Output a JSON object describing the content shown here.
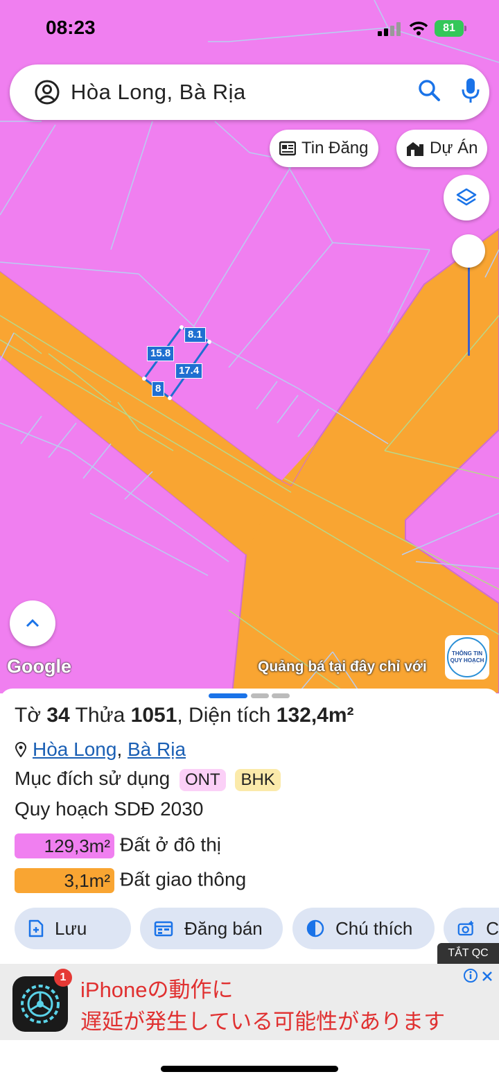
{
  "status_bar": {
    "time": "08:23",
    "battery": "81"
  },
  "search": {
    "query": "Hòa Long, Bà Rịa"
  },
  "chips": {
    "listings": "Tin Đăng",
    "projects": "Dự Án"
  },
  "map": {
    "attribution": "Google",
    "promo": "Quảng bá tại đây chỉ với",
    "logo_line1": "THÔNG TIN",
    "logo_line2": "QUY HOẠCH",
    "measurements": {
      "top": "8.1",
      "left": "15.8",
      "right": "17.4",
      "bottom": "8"
    }
  },
  "parcel": {
    "sheet_label": "Tờ",
    "sheet_no": "34",
    "plot_label": "Thửa",
    "plot_no": "1051",
    "area_label": ", Diện tích",
    "area_value": "132,4m²",
    "ward": "Hòa Long",
    "city": "Bà Rịa",
    "usage_label": "Mục đích sử dụng",
    "usage_tags": [
      "ONT",
      "BHK"
    ],
    "plan_label": "Quy hoạch SDĐ 2030",
    "plan_items": [
      {
        "area": "129,3m²",
        "label": "Đất ở đô thị",
        "color": "#f07ff0"
      },
      {
        "area": "3,1m²",
        "label": "Đất giao thông",
        "color": "#f9a532"
      }
    ]
  },
  "actions": {
    "save": "Lưu",
    "sell": "Đăng bán",
    "legend": "Chú thích",
    "capture": "C"
  },
  "ad": {
    "close_label": "TẮT QC",
    "badge": "1",
    "line1": "iPhoneの動作に",
    "line2": "遅延が発生している可能性があります"
  },
  "colors": {
    "residential": "#f07ff0",
    "road": "#f9a532",
    "accent": "#1a73e8"
  }
}
